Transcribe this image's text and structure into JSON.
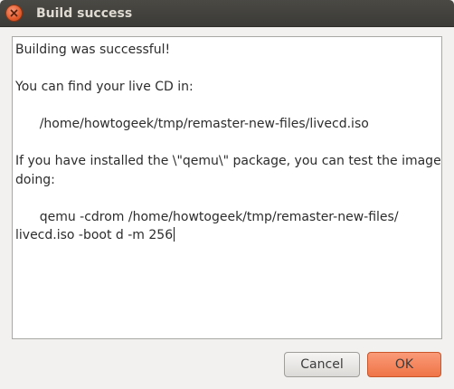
{
  "window": {
    "title": "Build success"
  },
  "message": {
    "lines": [
      "Building was successful!",
      "",
      "You can find your live CD in:",
      "",
      "      /home/howtogeek/tmp/remaster-new-files/livecd.iso",
      "",
      "If you have installed the \\\"qemu\\\" package, you can test the image by",
      "doing:",
      "",
      "      qemu -cdrom /home/howtogeek/tmp/remaster-new-files/",
      "livecd.iso -boot d -m 256"
    ]
  },
  "buttons": {
    "cancel_label": "Cancel",
    "ok_label": "OK"
  },
  "colors": {
    "titlebar": "#3c3b37",
    "close_button": "#e35b2c",
    "ok_button": "#ef7547",
    "dialog_background": "#f2f1f0"
  },
  "icons": {
    "close": "close-icon"
  }
}
